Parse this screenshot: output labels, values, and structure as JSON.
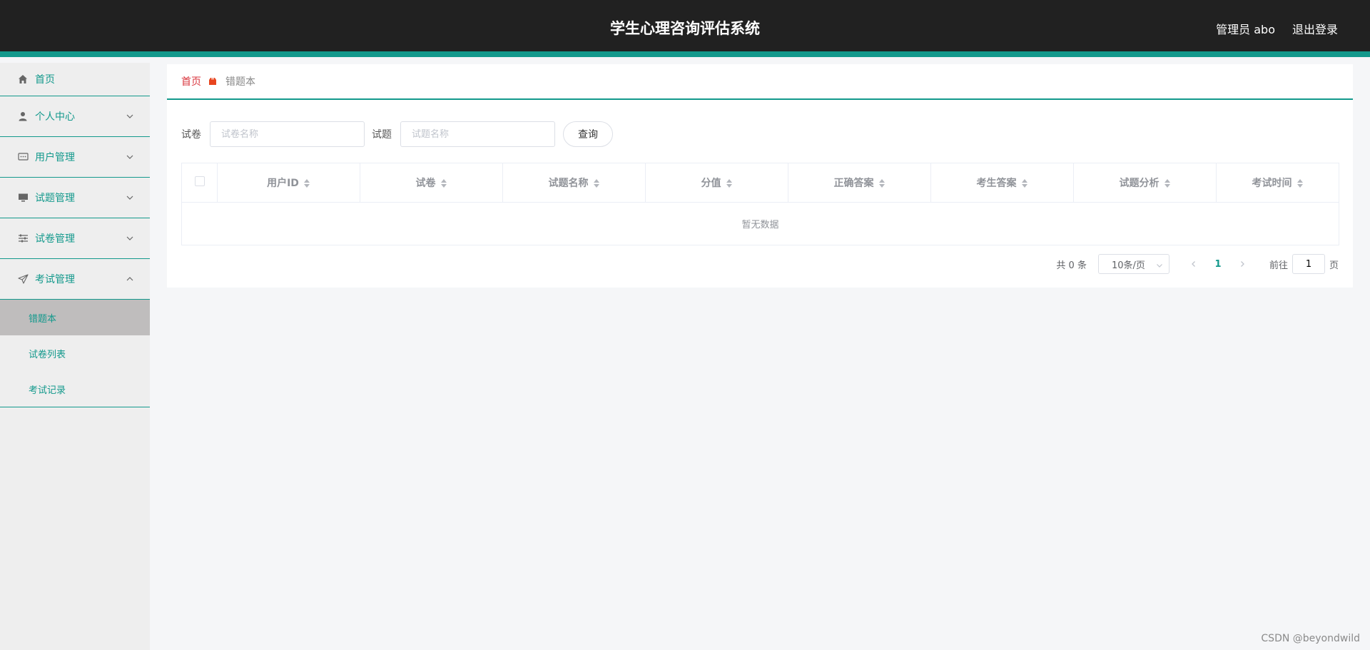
{
  "header": {
    "title": "学生心理咨询评估系统",
    "user_label": "管理员 abo",
    "logout_label": "退出登录"
  },
  "sidebar": {
    "items": [
      {
        "label": "首页",
        "icon": "home-icon"
      },
      {
        "label": "个人中心",
        "icon": "user-icon"
      },
      {
        "label": "用户管理",
        "icon": "message-icon"
      },
      {
        "label": "试题管理",
        "icon": "monitor-icon"
      },
      {
        "label": "试卷管理",
        "icon": "sliders-icon"
      },
      {
        "label": "考试管理",
        "icon": "send-icon"
      }
    ],
    "subitems": [
      {
        "label": "错题本",
        "active": true
      },
      {
        "label": "试卷列表"
      },
      {
        "label": "考试记录"
      }
    ]
  },
  "breadcrumb": {
    "home": "首页",
    "current": "错题本"
  },
  "search": {
    "paper_label": "试卷",
    "paper_placeholder": "试卷名称",
    "question_label": "试题",
    "question_placeholder": "试题名称",
    "query_button": "查询"
  },
  "table": {
    "columns": [
      "用户ID",
      "试卷",
      "试题名称",
      "分值",
      "正确答案",
      "考生答案",
      "试题分析",
      "考试时间"
    ],
    "empty_text": "暂无数据"
  },
  "pagination": {
    "total_text": "共 0 条",
    "page_size": "10条/页",
    "current_page": "1",
    "goto_label": "前往",
    "goto_value": "1",
    "page_suffix": "页"
  },
  "watermark": "CSDN @beyondwild",
  "colors": {
    "accent": "#13998c",
    "topbar": "#212121",
    "breadcrumb_home": "#d9363e",
    "active_submenu": "#bfbdbd"
  }
}
